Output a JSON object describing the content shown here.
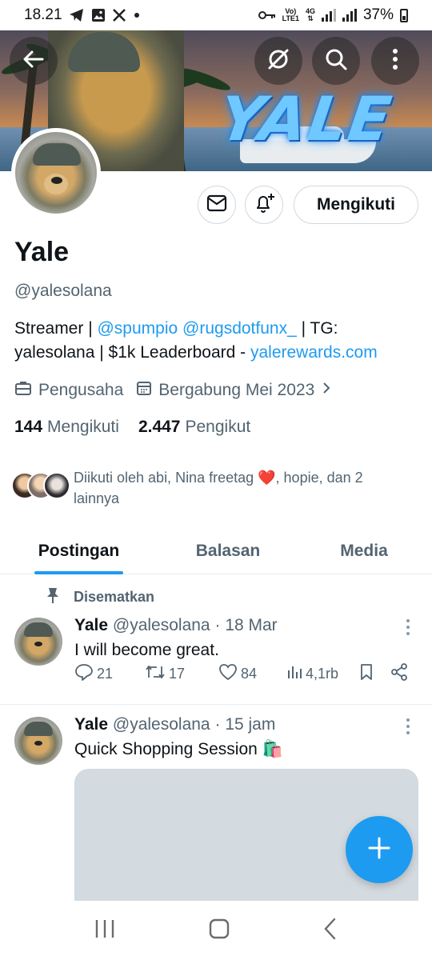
{
  "status_bar": {
    "time": "18.21",
    "network_top": "Vo)",
    "network_bottom": "LTE1",
    "network_type": "4G",
    "battery": "37%",
    "icons": [
      "telegram-icon",
      "gallery-icon",
      "x-icon",
      "dot-icon",
      "key-icon",
      "signal-icon",
      "battery-icon"
    ]
  },
  "banner": {
    "logo_text": "YALE",
    "buttons": [
      "back-arrow-icon",
      "grok-icon",
      "search-icon",
      "more-vertical-icon"
    ]
  },
  "profile": {
    "name": "Yale",
    "handle": "@yalesolana",
    "follow_button": "Mengikuti",
    "bio": {
      "p1": "Streamer | ",
      "link1": "@spumpio",
      "p2": " ",
      "link2": "@rugsdotfunx_",
      "p3": " | TG: yalesolana | $1k Leaderboard - ",
      "link3": "yalerewards.com"
    },
    "category": "Pengusaha",
    "joined": "Bergabung Mei 2023",
    "following_count": "144",
    "following_label": "Mengikuti",
    "followers_count": "2.447",
    "followers_label": "Pengikut",
    "followed_by_a": "Diikuti oleh abi, Nina freetag ",
    "followed_by_emoji": "❤️",
    "followed_by_b": ", hopie, dan 2 lainnya"
  },
  "tabs": [
    {
      "label": "Postingan",
      "active": true
    },
    {
      "label": "Balasan",
      "active": false
    },
    {
      "label": "Media",
      "active": false
    }
  ],
  "pinned_label": "Disematkan",
  "posts": [
    {
      "name": "Yale",
      "handle": "@yalesolana",
      "sep": "·",
      "time": "18 Mar",
      "text": "I will become great.",
      "replies": "21",
      "reposts": "17",
      "likes": "84",
      "views": "4,1rb"
    },
    {
      "name": "Yale",
      "handle": "@yalesolana",
      "sep": "·",
      "time": "15 jam",
      "text": "Quick Shopping Session",
      "emoji": "🛍️"
    }
  ],
  "colors": {
    "accent": "#1d9bf0",
    "text_primary": "#0f1419",
    "text_secondary": "#536471",
    "border": "#cfd9de"
  }
}
